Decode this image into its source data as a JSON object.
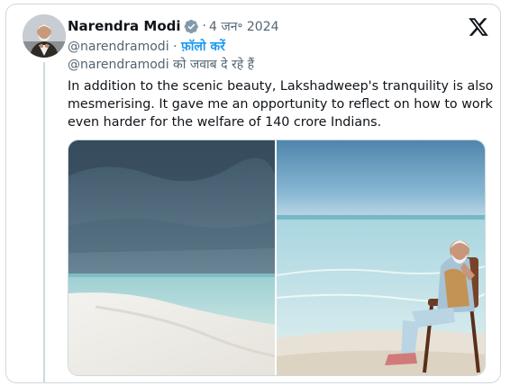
{
  "tweet": {
    "author_name": "Narendra Modi",
    "separator": "·",
    "date": "4 जन॰ 2024",
    "handle": "@narendramodi",
    "follow_label": "फ़ॉलो करें",
    "reply_to": "@narendramodi को जवाब दे रहे हैं",
    "text_lines": [
      "In addition to the scenic beauty, Lakshadweep's tranquility is also",
      "mesmerising. It gave me an opportunity to reflect on how to work",
      "even harder for the welfare of 140 crore Indians."
    ]
  },
  "icons": {
    "verified": "verified-badge-icon",
    "platform_logo": "x-logo-icon"
  },
  "colors": {
    "accent": "#1d9bf0",
    "verified_badge": "#829aab",
    "secondary_text": "#536471",
    "border": "#cfd9de"
  }
}
